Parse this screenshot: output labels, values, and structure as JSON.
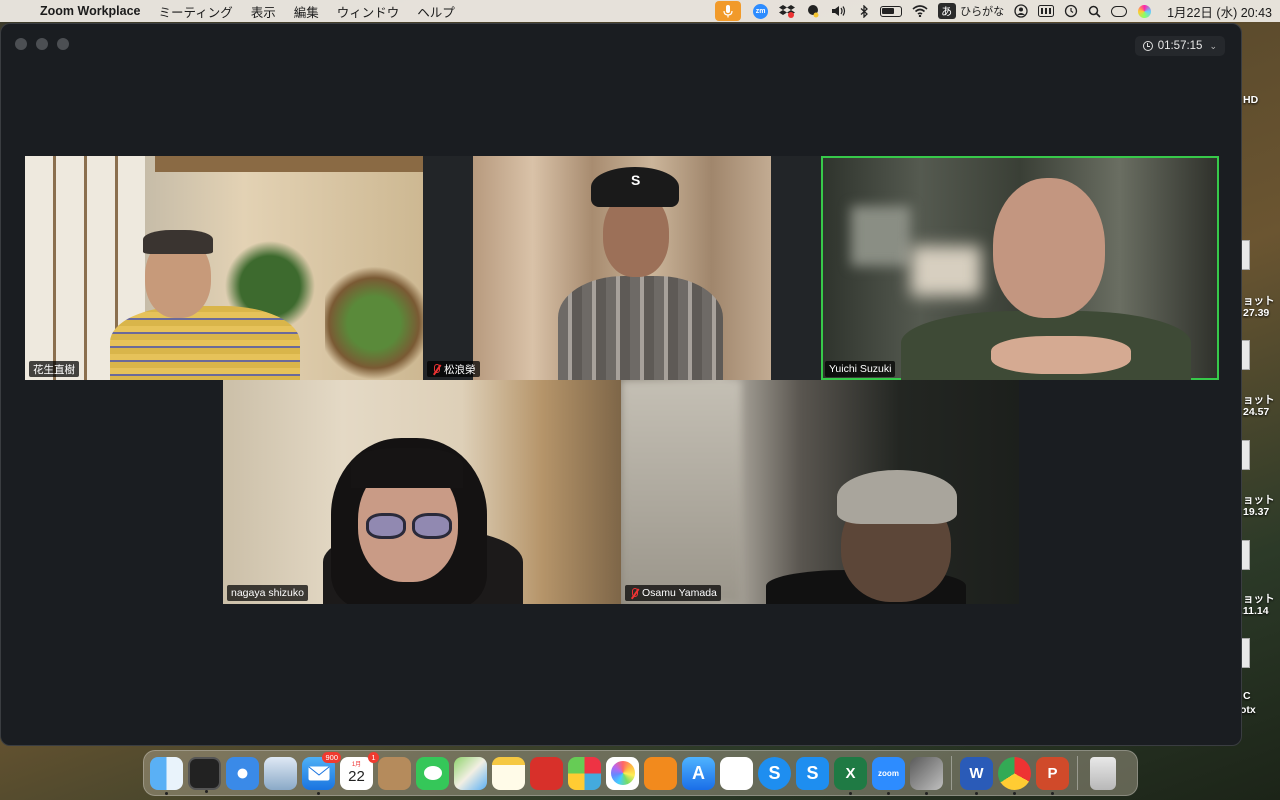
{
  "menubar": {
    "app": "Zoom Workplace",
    "items": [
      "ミーティング",
      "表示",
      "編集",
      "ウィンドウ",
      "ヘルプ"
    ],
    "ime_indicator": "あ",
    "ime_label": "ひらがな",
    "datetime": "1月22日 (水)  20:43"
  },
  "meeting": {
    "elapsed": "01:57:15",
    "participants": [
      {
        "name": "花生直樹",
        "muted": false,
        "active": false
      },
      {
        "name": "松浪榮",
        "muted": true,
        "active": false
      },
      {
        "name": "Yuichi Suzuki",
        "muted": false,
        "active": true
      },
      {
        "name": "nagaya shizuko",
        "muted": false,
        "active": false
      },
      {
        "name": "Osamu Yamada",
        "muted": true,
        "active": false
      }
    ]
  },
  "desktop": {
    "drive_label": "HD",
    "files": [
      "ョット",
      "27.39",
      "ョット",
      "24.57",
      "ョット",
      "19.37",
      "ョット",
      ".11.14",
      "C",
      "otx"
    ]
  },
  "dock": {
    "apps": [
      "Finder",
      "Mission Control",
      "Safari",
      "Preview",
      "Mail",
      "Calendar",
      "Contacts",
      "Messages",
      "Maps",
      "Notes",
      "Photo Booth",
      "Launchpad",
      "Photos",
      "Books",
      "App Store",
      "Reminders",
      "Skype",
      "Skype for Business",
      "Excel",
      "Zoom",
      "Keynote",
      "Word",
      "Chrome",
      "PowerPoint",
      "Trash"
    ],
    "mail_badge": "900",
    "calendar_badge": "1",
    "calendar_month": "1月",
    "calendar_day": "22",
    "zoom_label": "zoom"
  },
  "colors": {
    "active_speaker": "#37c94a",
    "muted_icon": "#e33333",
    "window_bg": "#1a1d21"
  }
}
